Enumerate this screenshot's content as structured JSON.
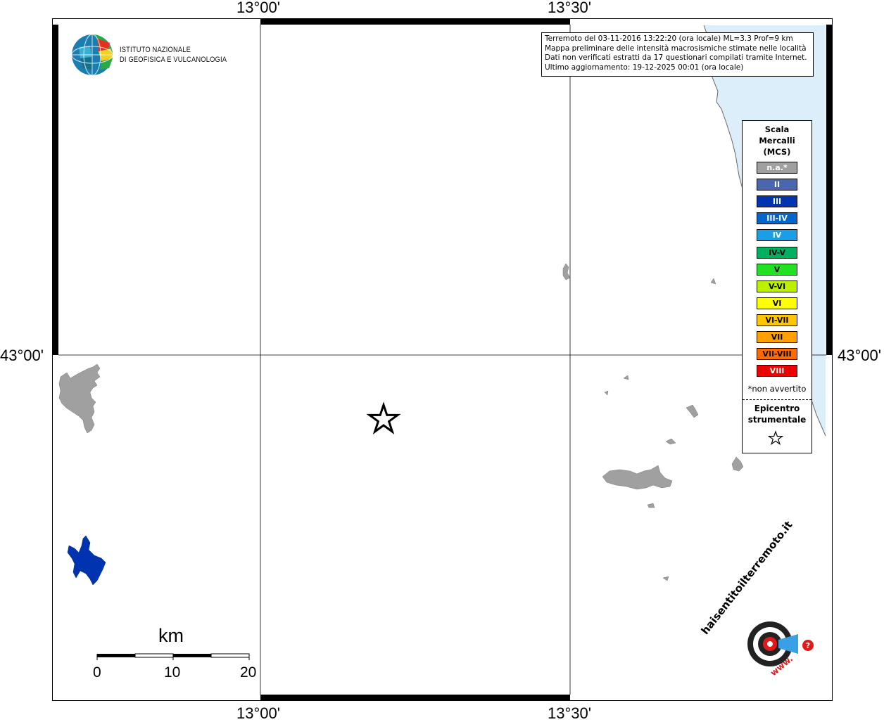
{
  "info": {
    "line1": "Terremoto del 03-11-2016 13:22:20 (ora locale) ML=3.3 Prof=9 km",
    "line2": "Mappa preliminare delle intensità macrosismiche stimate nelle località",
    "line3": "Dati non verificati estratti da 17 questionari compilati tramite Internet.",
    "line4": "Ultimo aggiornamento: 19-12-2025 00:01 (ora locale)"
  },
  "axes": {
    "lon_left": "13°00'",
    "lon_right": "13°30'",
    "lat_mid": "43°00'"
  },
  "logo_ingv": {
    "line1": "ISTITUTO NAZIONALE",
    "line2": "DI GEOFISICA E VULCANOLOGIA"
  },
  "legend": {
    "title": [
      "Scala",
      "Mercalli",
      "(MCS)"
    ],
    "items": [
      {
        "label": "n.a.*",
        "color": "#a0a0a0",
        "text_color": "#ffffff"
      },
      {
        "label": "II",
        "color": "#4a66b0",
        "text_color": "#ffffff"
      },
      {
        "label": "III",
        "color": "#0033b0",
        "text_color": "#ffffff"
      },
      {
        "label": "III-IV",
        "color": "#0066cc",
        "text_color": "#ffffff"
      },
      {
        "label": "IV",
        "color": "#1a9ee6",
        "text_color": "#ffffff"
      },
      {
        "label": "IV-V",
        "color": "#00b060",
        "text_color": "#000000"
      },
      {
        "label": "V",
        "color": "#22e022",
        "text_color": "#000000"
      },
      {
        "label": "V-VI",
        "color": "#bbf000",
        "text_color": "#000000"
      },
      {
        "label": "VI",
        "color": "#ffff00",
        "text_color": "#000000"
      },
      {
        "label": "VI-VII",
        "color": "#ffc600",
        "text_color": "#000000"
      },
      {
        "label": "VII",
        "color": "#ffa000",
        "text_color": "#000000"
      },
      {
        "label": "VII-VIII",
        "color": "#ff6a00",
        "text_color": "#000000"
      },
      {
        "label": "VIII",
        "color": "#ee0000",
        "text_color": "#ffffff"
      }
    ],
    "note": "*non avvertito",
    "epicenter_title": [
      "Epicentro",
      "strumentale"
    ]
  },
  "scale_bar": {
    "unit": "km",
    "ticks": [
      "0",
      "10",
      "20"
    ]
  },
  "logo_hsit": {
    "text_outer": "haisentitoilterremoto.it",
    "text_www": "www."
  },
  "colors": {
    "sea": "#ddeefb",
    "land_urban": "#a0a0a0",
    "lake": "#0033b0",
    "frame": "#000000"
  }
}
